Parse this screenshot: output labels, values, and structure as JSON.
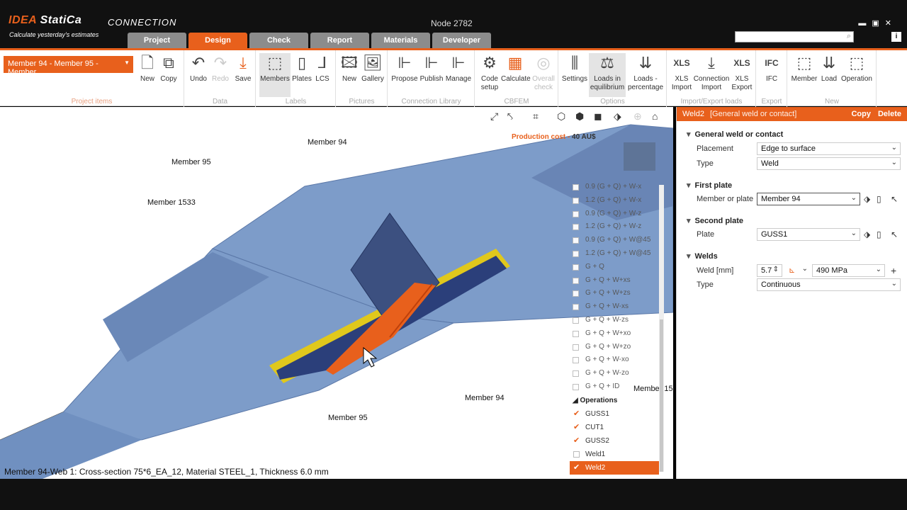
{
  "app": {
    "logo_a": "IDEA",
    "logo_b": "StatiCa",
    "tagline": "Calculate yesterday's estimates",
    "product": "CONNECTION",
    "title": "Node 2782"
  },
  "tabs": [
    "Project",
    "Design",
    "Check",
    "Report",
    "Materials",
    "Developer"
  ],
  "active_tab": "Design",
  "ribbon": {
    "member_select": "Member 94 - Member 95 - Member",
    "groups": {
      "project_items": "Project items",
      "data": "Data",
      "labels": "Labels",
      "pictures": "Pictures",
      "connection_library": "Connection Library",
      "cbfem": "CBFEM",
      "options": "Options",
      "import_export": "Import/Export loads",
      "export": "Export",
      "new": "New"
    },
    "buttons": {
      "new": "New",
      "copy": "Copy",
      "undo": "Undo",
      "redo": "Redo",
      "save": "Save",
      "members": "Members",
      "plates": "Plates",
      "lcs": "LCS",
      "pic_new": "New",
      "gallery": "Gallery",
      "propose": "Propose",
      "publish": "Publish",
      "manage": "Manage",
      "code_setup_1": "Code",
      "code_setup_2": "setup",
      "calculate": "Calculate",
      "overall_1": "Overall",
      "overall_2": "check",
      "settings": "Settings",
      "loads_eq_1": "Loads in",
      "loads_eq_2": "equilibrium",
      "loads_pct_1": "Loads -",
      "loads_pct_2": "percentage",
      "xls_import_1": "XLS",
      "xls_import_2": "Import",
      "conn_import_1": "Connection",
      "conn_import_2": "Import",
      "xls_export_1": "XLS",
      "xls_export_2": "Export",
      "ifc": "IFC",
      "member": "Member",
      "load": "Load",
      "operation": "Operation"
    }
  },
  "viewport": {
    "production_cost_label": "Production cost",
    "production_cost_value": "40 AU$",
    "member_labels": {
      "m94_top": "Member 94",
      "m95_top": "Member 95",
      "m1533": "Member 1533",
      "m94_bottom": "Member 94",
      "m95_bottom": "Member 95",
      "m15_right": "Member 15"
    },
    "status_line": "Member 94-Web 1: Cross-section 75*6_EA_12, Material STEEL_1, Thickness 6.0 mm"
  },
  "load_cases": [
    "0.9 (G + Q) + W-x",
    "1.2 (G + Q) + W-x",
    "0.9 (G + Q) + W-z",
    "1.2 (G + Q) + W-z",
    "0.9 (G + Q) + W@45",
    "1.2 (G + Q) + W@45",
    "G + Q",
    "G + Q + W+xs",
    "G + Q + W+zs",
    "G + Q + W-xs",
    "G + Q + W-zs",
    "G + Q + W+xo",
    "G + Q + W+zo",
    "G + Q + W-xo",
    "G + Q + W-zo",
    "G + Q + ID"
  ],
  "operations": {
    "header": "Operations",
    "items": [
      {
        "label": "GUSS1",
        "checked": true
      },
      {
        "label": "CUT1",
        "checked": true
      },
      {
        "label": "GUSS2",
        "checked": true
      },
      {
        "label": "Weld1",
        "checked": false
      },
      {
        "label": "Weld2",
        "checked": true,
        "selected": true
      }
    ]
  },
  "panel": {
    "title": "Weld2",
    "subtitle": "[General weld or contact]",
    "copy": "Copy",
    "delete": "Delete",
    "sections": {
      "general": "General weld or contact",
      "first_plate": "First plate",
      "second_plate": "Second plate",
      "welds": "Welds"
    },
    "labels": {
      "placement": "Placement",
      "type": "Type",
      "member_or_plate": "Member or plate",
      "plate": "Plate",
      "weld_mm": "Weld [mm]",
      "weld_type": "Type"
    },
    "values": {
      "placement": "Edge to surface",
      "type": "Weld",
      "member_or_plate": "Member 94",
      "plate": "GUSS1",
      "weld_size": "5.7",
      "weld_material": "490 MPa",
      "weld_type": "Continuous"
    }
  },
  "colors": {
    "accent": "#e8601c",
    "steel": "#7d9cc9",
    "weld": "#e8d21c",
    "plate_dark": "#2b3f7a"
  }
}
